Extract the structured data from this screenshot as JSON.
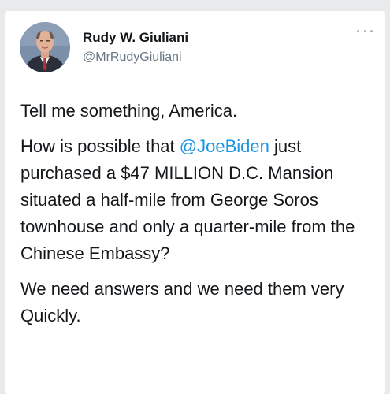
{
  "tweet": {
    "display_name": "Rudy W. Giuliani",
    "handle": "@MrRudyGiuliani",
    "more_icon": "ellipsis-icon",
    "paragraph1": "Tell me something, America.",
    "paragraph2_before": "How is possible that ",
    "mention": "@JoeBiden",
    "paragraph2_after": " just purchased a $47 MILLION D.C. Mansion situated a half-mile from George Soros townhouse and only a quarter-mile from the Chinese Embassy?",
    "paragraph3": "We need answers and we need them very Quickly."
  },
  "colors": {
    "mention": "#1b95e0",
    "text": "#14171a",
    "secondary": "#657786"
  }
}
